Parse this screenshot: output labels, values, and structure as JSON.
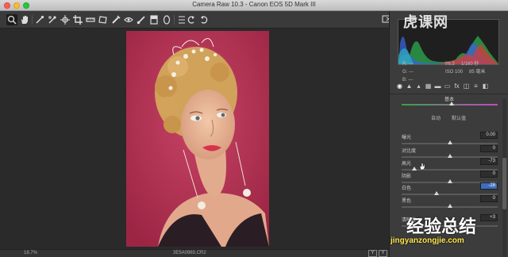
{
  "window": {
    "title": "Camera Raw 10.3 - Canon EOS 5D Mark III"
  },
  "toolbar": {
    "tools": [
      "zoom-tool",
      "hand-tool",
      "white-balance-tool",
      "color-sampler-tool",
      "targeted-adjustment-tool",
      "crop-tool",
      "straighten-tool",
      "transform-tool",
      "spot-removal-tool",
      "red-eye-tool",
      "adjustment-brush-tool",
      "graduated-filter-tool",
      "radial-filter-tool",
      "preferences-tool",
      "rotate-ccw-tool",
      "rotate-cw-tool"
    ]
  },
  "histogram": {
    "rgb": {
      "r_label": "R:",
      "r": "---",
      "g_label": "G:",
      "g": "---",
      "b_label": "B:",
      "b": "---"
    },
    "camera": {
      "aperture": "f/6.3",
      "shutter": "1/160 秒",
      "iso": "ISO 100",
      "focal": "85 毫米"
    }
  },
  "panel": {
    "section_title": "基本",
    "auto_label": "自动",
    "default_label": "默认值",
    "sliders": [
      {
        "label": "曝光",
        "value": "0.00",
        "pos": 0.5,
        "selected": false
      },
      {
        "label": "对比度",
        "value": "0",
        "pos": 0.5,
        "selected": false
      },
      {
        "label": "高光",
        "value": "-73",
        "pos": 0.135,
        "selected": false
      },
      {
        "label": "阴影",
        "value": "0",
        "pos": 0.5,
        "selected": false
      },
      {
        "label": "白色",
        "value": "-28",
        "pos": 0.36,
        "selected": true
      },
      {
        "label": "黑色",
        "value": "0",
        "pos": 0.5,
        "selected": false
      },
      {
        "label": "清晰度",
        "value": "+3",
        "pos": 0.515,
        "selected": false
      }
    ]
  },
  "status": {
    "zoom": "18.7%",
    "filename": "3E5A0965.CR2",
    "view_buttons": [
      "Y",
      "Y"
    ]
  },
  "watermark": {
    "top": "虎课网",
    "bottom_cn": "经验总结",
    "bottom_url": "jingyanzongjie.com"
  },
  "colors": {
    "photo_bg": "#b73655",
    "histogram_blue": "#3a63d8",
    "histogram_green": "#3fbf4a",
    "histogram_red": "#d83a3a"
  }
}
